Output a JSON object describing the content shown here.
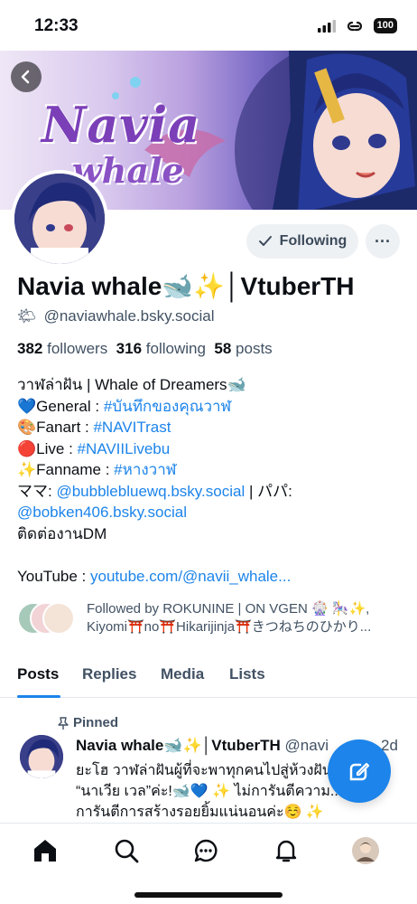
{
  "status_bar": {
    "time": "12:33",
    "battery": "100"
  },
  "profile": {
    "display_name": "Navia whale🐋✨│VtuberTH",
    "handle": "@naviawhale.bsky.social",
    "handle_emoji": "🌤",
    "follow_button": "Following",
    "more_button": "···",
    "stats": {
      "followers_count": "382",
      "followers_label": "followers",
      "following_count": "316",
      "following_label": "following",
      "posts_count": "58",
      "posts_label": "posts"
    },
    "bio": {
      "line1": "วาฬล่าฝัน | Whale of Dreamers🐋",
      "line2_prefix": "💙General : ",
      "line2_link": "#บันทึกของคุณวาฬ",
      "line3_prefix": "🎨Fanart : ",
      "line3_link": "#NAVITrast",
      "line4_prefix": "🔴Live : ",
      "line4_link": "#NAVIILivebu",
      "line5_prefix": "✨Fanname : ",
      "line5_link": "#หางวาฬ",
      "line6_prefix": "ママ: ",
      "line6_link": "@bubblebluewq.bsky.social",
      "line6_suffix": " | パパ:",
      "line7_link": "@bobken406.bsky.social",
      "line8": "ติดต่องานDM",
      "line10_prefix": "YouTube : ",
      "line10_link": "youtube.com/@navii_whale..."
    },
    "followed_by": {
      "line1": "Followed by ROKUNINE | ON VGEN 🎡 🎠✨,",
      "line2": "Kiyomi⛩️no⛩️Hikarijinja⛩️きつねちのひかり..."
    }
  },
  "banner": {
    "logo_line1": "Navia",
    "logo_line2": "whale"
  },
  "tabs": [
    {
      "label": "Posts",
      "active": true
    },
    {
      "label": "Replies",
      "active": false
    },
    {
      "label": "Media",
      "active": false
    },
    {
      "label": "Lists",
      "active": false
    }
  ],
  "pinned_post": {
    "pinned_label": "Pinned",
    "author_name": "Navia whale🐋✨│VtuberTH",
    "author_handle": "@navi",
    "time": "2d",
    "text_line1": "ยะโฮ วาฬล่าฝันผู้ที่จะพาทุกคนไปสู่ห้วงฝัน",
    "text_line2": "“นาเวีย เวล”ค่ะ!🐋💙 ✨ ไม่การันตีความ... แต่",
    "text_line3": "การันตีการสร้างรอยยิ้มแน่นอนค่ะ☺️ ✨"
  },
  "colors": {
    "accent": "#1c84ea",
    "secondary_text": "#415163",
    "button_bg": "#eef1f4"
  },
  "icons": {
    "back": "chevron-left-icon",
    "compose": "pencil-icon",
    "home": "home-icon",
    "search": "search-icon",
    "chat": "chat-icon",
    "notifications": "bell-icon",
    "profile": "profile-avatar"
  }
}
